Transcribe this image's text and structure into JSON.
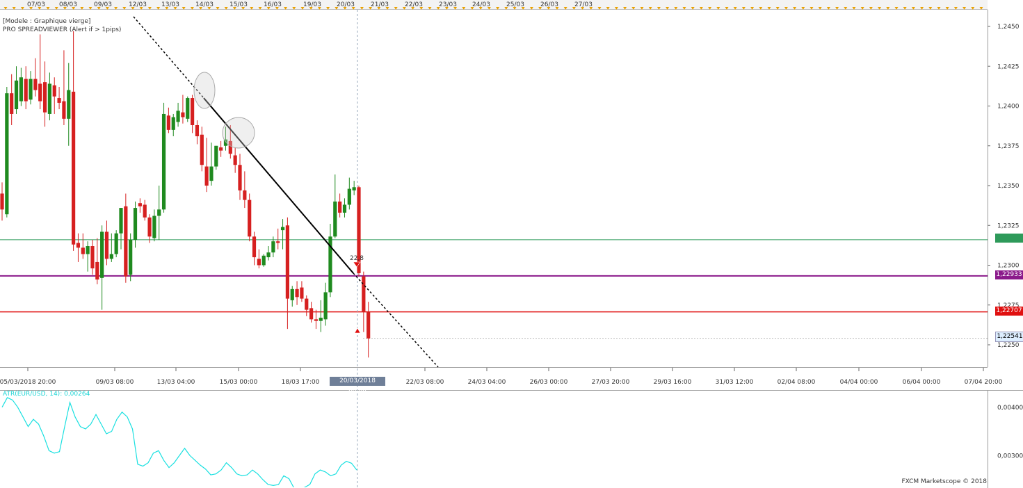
{
  "legend": {
    "line1": "[Modele : Graphique vierge]",
    "line2": "PRO SPREADVIEWER (Alert if > 1pips)"
  },
  "top_dates": [
    "07/03",
    "08/03",
    "09/03",
    "12/03",
    "13/03",
    "14/03",
    "15/03",
    "16/03",
    "19/03",
    "20/03",
    "21/03",
    "22/03",
    "23/03",
    "24/03",
    "25/03",
    "26/03",
    "27/03"
  ],
  "price_ticks": [
    "1,2450",
    "1,2425",
    "1,2400",
    "1,2375",
    "1,2350",
    "1,2325",
    "1,2300",
    "1,2275",
    "1,2250"
  ],
  "time_ticks": [
    "05/03/2018 20:00",
    "09/03 08:00",
    "13/03 04:00",
    "15/03 00:00",
    "18/03 17:00",
    "22/03 08:00",
    "24/03 04:00",
    "26/03 00:00",
    "27/03 20:00",
    "29/03 16:00",
    "31/03 12:00",
    "02/04 08:00",
    "04/04 00:00",
    "06/04 00:00",
    "07/04 20:00"
  ],
  "cursor_time": "20/03/2018 08:00",
  "level_tags": {
    "green": "",
    "purple": "1,22933",
    "red": "1,22707",
    "current": "1,22541"
  },
  "marker_text": "22,8",
  "atr": {
    "label": "ATR(EUR/USD, 14): 0,00264",
    "ticks": [
      "0,00400",
      "0,00300"
    ]
  },
  "copyright": "FXCM Marketscope © 2018",
  "colors": {
    "bull": "#1f8a1f",
    "bear": "#d62020",
    "green_line": "#2e9a5a",
    "purple_line": "#8b1a8b",
    "red_line": "#e01010",
    "atr_line": "#19e0e0",
    "cursor_bg": "#6f7f98"
  },
  "chart_data": {
    "type": "candlestick",
    "instrument": "EUR/USD",
    "ylim": [
      1.2235,
      1.246
    ],
    "levels": {
      "green": 1.2316,
      "purple": 1.22933,
      "red": 1.22707,
      "current": 1.22541
    },
    "candles": [
      {
        "o": 1.2345,
        "h": 1.2352,
        "c": 1.2335,
        "l": 1.2328
      },
      {
        "o": 1.2332,
        "h": 1.2412,
        "c": 1.2408,
        "l": 1.233
      },
      {
        "o": 1.2408,
        "h": 1.242,
        "c": 1.2395,
        "l": 1.2388
      },
      {
        "o": 1.2398,
        "h": 1.2425,
        "c": 1.2416,
        "l": 1.2395
      },
      {
        "o": 1.2403,
        "h": 1.2424,
        "c": 1.2418,
        "l": 1.24
      },
      {
        "o": 1.2417,
        "h": 1.2425,
        "c": 1.2403,
        "l": 1.2398
      },
      {
        "o": 1.2404,
        "h": 1.2422,
        "c": 1.2417,
        "l": 1.2401
      },
      {
        "o": 1.2417,
        "h": 1.243,
        "c": 1.241,
        "l": 1.2406
      },
      {
        "o": 1.2414,
        "h": 1.2445,
        "c": 1.2403,
        "l": 1.2398
      },
      {
        "o": 1.2415,
        "h": 1.2428,
        "c": 1.2396,
        "l": 1.2387
      },
      {
        "o": 1.2395,
        "h": 1.2421,
        "c": 1.2414,
        "l": 1.2391
      },
      {
        "o": 1.2413,
        "h": 1.2418,
        "c": 1.2406,
        "l": 1.2395
      },
      {
        "o": 1.2405,
        "h": 1.2412,
        "c": 1.2402,
        "l": 1.2398
      },
      {
        "o": 1.2403,
        "h": 1.2435,
        "c": 1.2392,
        "l": 1.2388
      },
      {
        "o": 1.2392,
        "h": 1.2427,
        "c": 1.241,
        "l": 1.2375
      },
      {
        "o": 1.2409,
        "h": 1.2447,
        "c": 1.2313,
        "l": 1.2309
      },
      {
        "o": 1.2314,
        "h": 1.232,
        "c": 1.2311,
        "l": 1.2302
      },
      {
        "o": 1.2311,
        "h": 1.232,
        "c": 1.2307,
        "l": 1.2304
      },
      {
        "o": 1.2307,
        "h": 1.2315,
        "c": 1.2312,
        "l": 1.2296
      },
      {
        "o": 1.2312,
        "h": 1.2316,
        "c": 1.2298,
        "l": 1.2294
      },
      {
        "o": 1.2302,
        "h": 1.2317,
        "c": 1.2291,
        "l": 1.2288
      },
      {
        "o": 1.2292,
        "h": 1.2325,
        "c": 1.2321,
        "l": 1.2272
      },
      {
        "o": 1.2321,
        "h": 1.2328,
        "c": 1.2304,
        "l": 1.23
      },
      {
        "o": 1.2304,
        "h": 1.232,
        "c": 1.2307,
        "l": 1.2302
      },
      {
        "o": 1.2307,
        "h": 1.2322,
        "c": 1.232,
        "l": 1.2305
      },
      {
        "o": 1.232,
        "h": 1.2332,
        "c": 1.2336,
        "l": 1.231
      },
      {
        "o": 1.2337,
        "h": 1.2345,
        "c": 1.2293,
        "l": 1.2289
      },
      {
        "o": 1.2294,
        "h": 1.232,
        "c": 1.2316,
        "l": 1.229
      },
      {
        "o": 1.2316,
        "h": 1.234,
        "c": 1.2336,
        "l": 1.2311
      },
      {
        "o": 1.2339,
        "h": 1.2342,
        "c": 1.2337,
        "l": 1.2333
      },
      {
        "o": 1.2338,
        "h": 1.2341,
        "c": 1.233,
        "l": 1.2328
      },
      {
        "o": 1.233,
        "h": 1.2332,
        "c": 1.2318,
        "l": 1.2314
      },
      {
        "o": 1.2317,
        "h": 1.2335,
        "c": 1.2331,
        "l": 1.2315
      },
      {
        "o": 1.2331,
        "h": 1.235,
        "c": 1.2335,
        "l": 1.2316
      },
      {
        "o": 1.2335,
        "h": 1.2402,
        "c": 1.2395,
        "l": 1.2333
      },
      {
        "o": 1.2394,
        "h": 1.2399,
        "c": 1.2385,
        "l": 1.2383
      },
      {
        "o": 1.2385,
        "h": 1.2395,
        "c": 1.2393,
        "l": 1.2381
      },
      {
        "o": 1.239,
        "h": 1.2402,
        "c": 1.2397,
        "l": 1.2387
      },
      {
        "o": 1.2396,
        "h": 1.2407,
        "c": 1.2393,
        "l": 1.2389
      },
      {
        "o": 1.2392,
        "h": 1.2406,
        "c": 1.2405,
        "l": 1.239
      },
      {
        "o": 1.2405,
        "h": 1.2407,
        "c": 1.2388,
        "l": 1.2383
      },
      {
        "o": 1.2388,
        "h": 1.2391,
        "c": 1.2381,
        "l": 1.2376
      },
      {
        "o": 1.2382,
        "h": 1.2387,
        "c": 1.2363,
        "l": 1.2359
      },
      {
        "o": 1.2362,
        "h": 1.238,
        "c": 1.235,
        "l": 1.2346
      },
      {
        "o": 1.2353,
        "h": 1.2377,
        "c": 1.2362,
        "l": 1.235
      },
      {
        "o": 1.2362,
        "h": 1.2375,
        "c": 1.2375,
        "l": 1.236
      },
      {
        "o": 1.2374,
        "h": 1.2378,
        "c": 1.2372,
        "l": 1.2368
      },
      {
        "o": 1.2375,
        "h": 1.2387,
        "c": 1.2379,
        "l": 1.2372
      },
      {
        "o": 1.2378,
        "h": 1.2388,
        "c": 1.237,
        "l": 1.2367
      },
      {
        "o": 1.2369,
        "h": 1.2374,
        "c": 1.2363,
        "l": 1.2358
      },
      {
        "o": 1.2363,
        "h": 1.237,
        "c": 1.2347,
        "l": 1.2341
      },
      {
        "o": 1.2347,
        "h": 1.2359,
        "c": 1.2341,
        "l": 1.2336
      },
      {
        "o": 1.2341,
        "h": 1.2345,
        "c": 1.2318,
        "l": 1.2315
      },
      {
        "o": 1.2318,
        "h": 1.2321,
        "c": 1.2305,
        "l": 1.23
      },
      {
        "o": 1.2304,
        "h": 1.231,
        "c": 1.23,
        "l": 1.2298
      },
      {
        "o": 1.23,
        "h": 1.2307,
        "c": 1.2306,
        "l": 1.2299
      },
      {
        "o": 1.2305,
        "h": 1.2312,
        "c": 1.2308,
        "l": 1.2303
      },
      {
        "o": 1.2308,
        "h": 1.2318,
        "c": 1.2315,
        "l": 1.2305
      },
      {
        "o": 1.2315,
        "h": 1.2323,
        "c": 1.2314,
        "l": 1.231
      },
      {
        "o": 1.2322,
        "h": 1.2329,
        "c": 1.2324,
        "l": 1.231
      },
      {
        "o": 1.2325,
        "h": 1.233,
        "c": 1.2279,
        "l": 1.226
      },
      {
        "o": 1.2278,
        "h": 1.2287,
        "c": 1.2285,
        "l": 1.2274
      },
      {
        "o": 1.2285,
        "h": 1.229,
        "c": 1.228,
        "l": 1.2275
      },
      {
        "o": 1.2286,
        "h": 1.229,
        "c": 1.2279,
        "l": 1.2277
      },
      {
        "o": 1.2279,
        "h": 1.2281,
        "c": 1.2272,
        "l": 1.2268
      },
      {
        "o": 1.2273,
        "h": 1.2277,
        "c": 1.2266,
        "l": 1.2264
      },
      {
        "o": 1.2266,
        "h": 1.2272,
        "c": 1.2265,
        "l": 1.226
      },
      {
        "o": 1.2265,
        "h": 1.2278,
        "c": 1.2267,
        "l": 1.2258
      },
      {
        "o": 1.2266,
        "h": 1.2289,
        "c": 1.2283,
        "l": 1.2262
      },
      {
        "o": 1.2283,
        "h": 1.2326,
        "c": 1.2318,
        "l": 1.228
      },
      {
        "o": 1.2318,
        "h": 1.2357,
        "c": 1.234,
        "l": 1.2317
      },
      {
        "o": 1.234,
        "h": 1.2345,
        "c": 1.2333,
        "l": 1.233
      },
      {
        "o": 1.2333,
        "h": 1.2342,
        "c": 1.2338,
        "l": 1.233
      },
      {
        "o": 1.2338,
        "h": 1.2355,
        "c": 1.2348,
        "l": 1.2335
      },
      {
        "o": 1.2347,
        "h": 1.2353,
        "c": 1.2349,
        "l": 1.2344
      },
      {
        "o": 1.2349,
        "h": 1.235,
        "c": 1.2295,
        "l": 1.2293
      },
      {
        "o": 1.2293,
        "h": 1.2296,
        "c": 1.2271,
        "l": 1.2258
      },
      {
        "o": 1.2271,
        "h": 1.2277,
        "c": 1.2254,
        "l": 1.2242
      }
    ],
    "trendline": {
      "from": 1.2405,
      "to": 1.2295
    }
  }
}
